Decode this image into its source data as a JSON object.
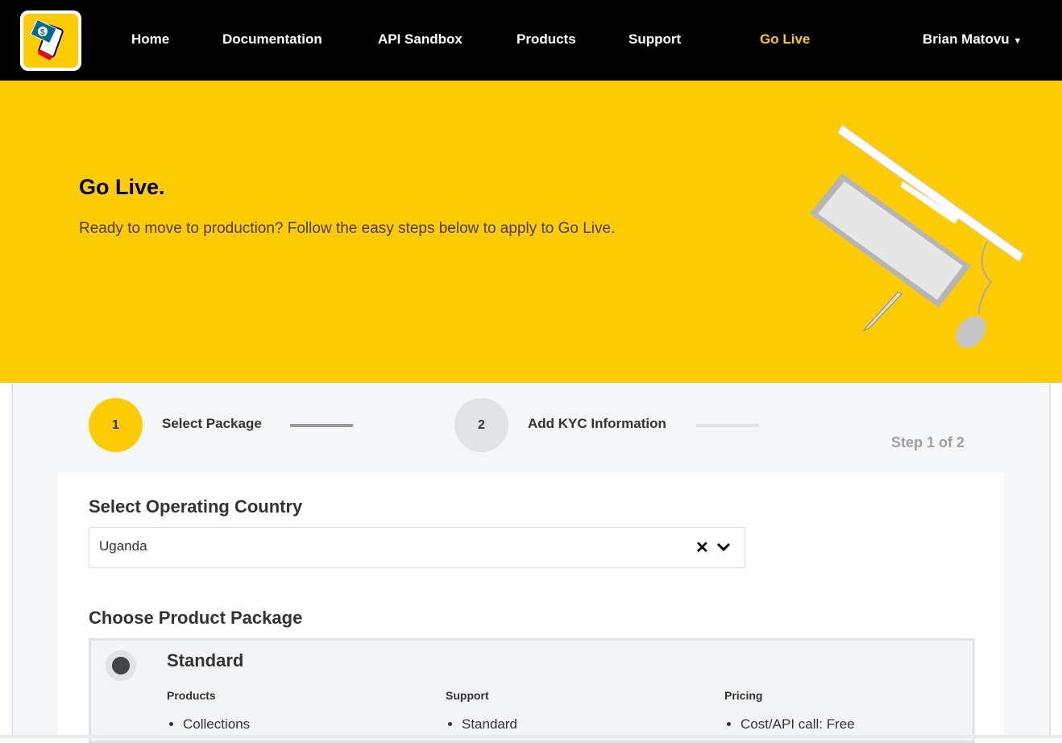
{
  "nav": {
    "items": [
      "Home",
      "Documentation",
      "API Sandbox",
      "Products",
      "Support",
      "Go Live"
    ],
    "active": "Go Live",
    "user": "Brian Matovu"
  },
  "hero": {
    "title": "Go Live.",
    "subtitle": "Ready to move to production? Follow the easy steps below to apply to Go Live."
  },
  "steps": {
    "items": [
      {
        "number": "1",
        "label": "Select Package"
      },
      {
        "number": "2",
        "label": "Add KYC Information"
      }
    ],
    "indicator": "Step 1 of 2"
  },
  "form": {
    "country_heading": "Select Operating Country",
    "country_value": "Uganda",
    "package_heading": "Choose Product Package",
    "package": {
      "name": "Standard",
      "columns": [
        {
          "title": "Products",
          "items": [
            "Collections"
          ]
        },
        {
          "title": "Support",
          "items": [
            "Standard"
          ]
        },
        {
          "title": "Pricing",
          "items": [
            "Cost/API call: Free"
          ]
        }
      ]
    }
  },
  "colors": {
    "brand": "#ffcb05",
    "nav_bg": "#000000"
  }
}
